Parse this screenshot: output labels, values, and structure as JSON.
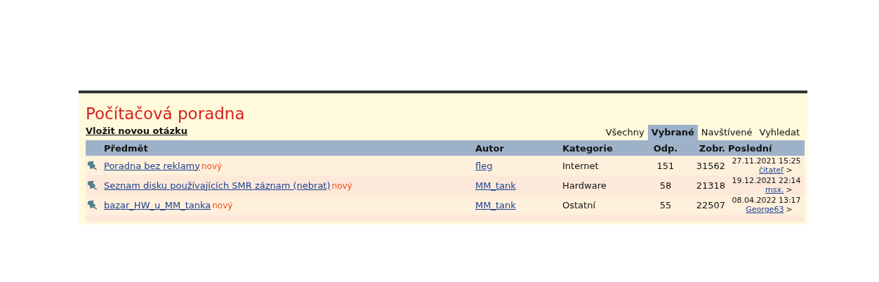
{
  "title": "Počítačová poradna",
  "new_question_link": "Vložit novou otázku",
  "tabs": [
    {
      "label": "Všechny",
      "selected": false
    },
    {
      "label": "Vybrané",
      "selected": true
    },
    {
      "label": "Navštívené",
      "selected": false
    },
    {
      "label": "Vyhledat",
      "selected": false
    }
  ],
  "table": {
    "columns": [
      "Předmět",
      "Autor",
      "Kategorie",
      "Odp.",
      "Zobr.",
      "Poslední"
    ],
    "rows": [
      {
        "subject": "Poradna bez reklamy",
        "badge": "nový",
        "author": "fleg",
        "category": "Internet",
        "replies": "151",
        "views": "31562",
        "last_time": "27.11.2021 15:25",
        "last_user": "čitateľ",
        "last_arrow": ">"
      },
      {
        "subject": "Seznam disku používajících SMR záznam (nebrat)",
        "badge": "nový",
        "author": "MM_tank",
        "category": "Hardware",
        "replies": "58",
        "views": "21318",
        "last_time": "19.12.2021 22:14",
        "last_user": "msx.",
        "last_arrow": ">"
      },
      {
        "subject": "bazar_HW_u_MM_tanka",
        "badge": "nový",
        "author": "MM_tank",
        "category": "Ostatní",
        "replies": "55",
        "views": "22507",
        "last_time": "08.04.2022 13:17",
        "last_user": "George63",
        "last_arrow": ">"
      }
    ]
  }
}
